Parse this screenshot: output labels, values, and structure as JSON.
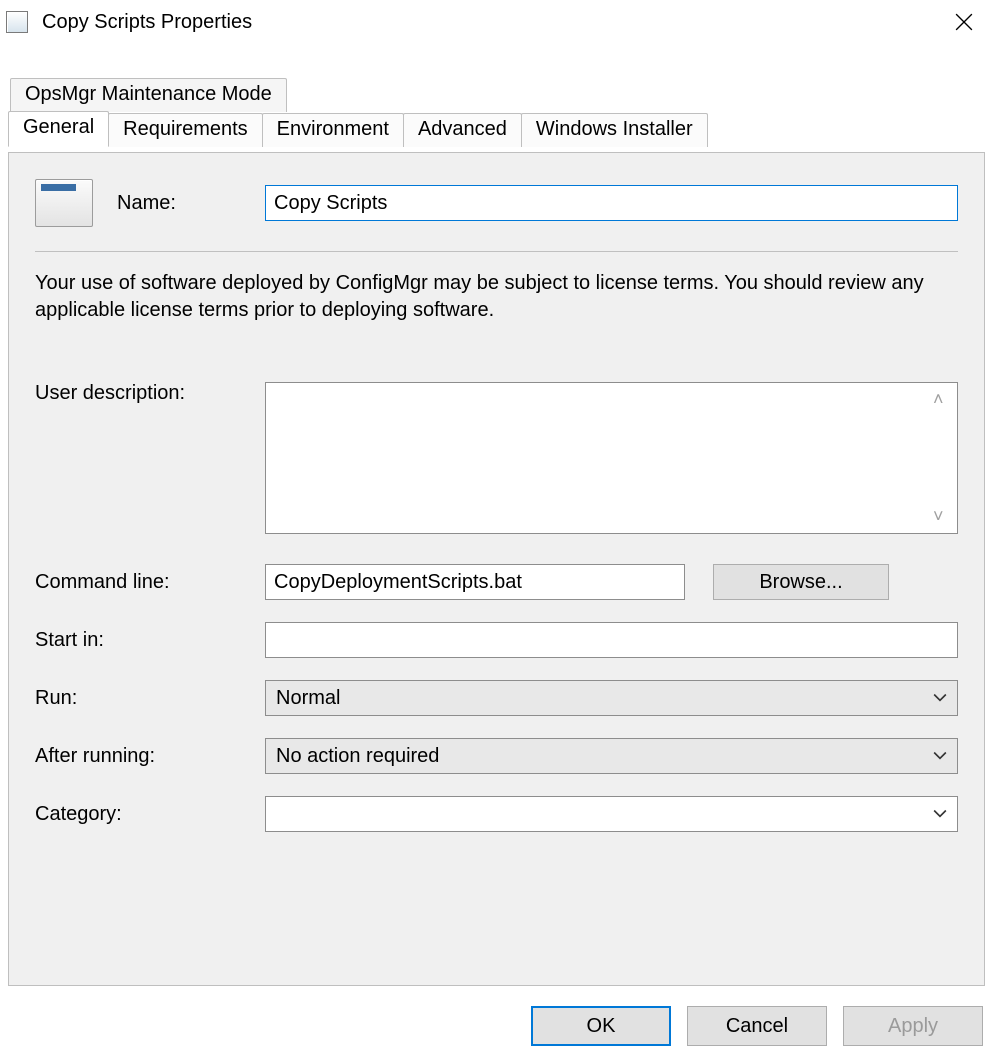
{
  "window": {
    "title": "Copy Scripts Properties"
  },
  "tabs": {
    "row1": [
      "OpsMgr Maintenance Mode"
    ],
    "row2": [
      "General",
      "Requirements",
      "Environment",
      "Advanced",
      "Windows Installer"
    ],
    "active": "General"
  },
  "general": {
    "name_label": "Name:",
    "name_value": "Copy Scripts",
    "license_text": "Your use of software deployed by ConfigMgr may be subject to license terms. You should review any applicable license terms prior to deploying software.",
    "user_description_label": "User description:",
    "user_description_value": "",
    "command_line_label": "Command line:",
    "command_line_value": "CopyDeploymentScripts.bat",
    "browse_label": "Browse...",
    "start_in_label": "Start in:",
    "start_in_value": "",
    "run_label": "Run:",
    "run_value": "Normal",
    "after_running_label": "After running:",
    "after_running_value": "No action required",
    "category_label": "Category:",
    "category_value": ""
  },
  "buttons": {
    "ok": "OK",
    "cancel": "Cancel",
    "apply": "Apply"
  }
}
